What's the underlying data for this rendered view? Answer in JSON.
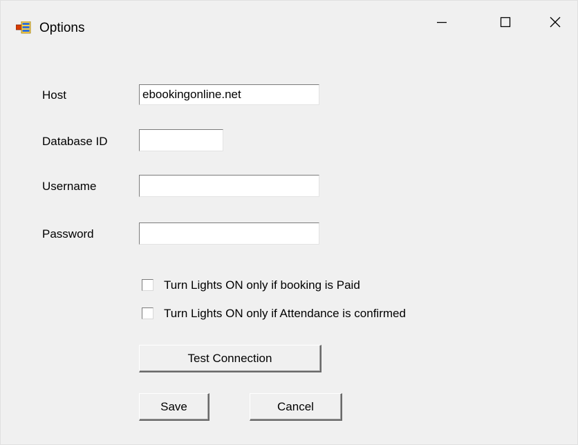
{
  "window": {
    "title": "Options"
  },
  "form": {
    "host": {
      "label": "Host",
      "value": "ebookingonline.net"
    },
    "database_id": {
      "label": "Database ID",
      "value": ""
    },
    "username": {
      "label": "Username",
      "value": ""
    },
    "password": {
      "label": "Password",
      "value": ""
    },
    "checkboxes": [
      {
        "label": "Turn Lights ON only if booking is Paid",
        "checked": false
      },
      {
        "label": "Turn Lights ON only if Attendance is confirmed",
        "checked": false
      }
    ]
  },
  "buttons": {
    "test_connection": "Test Connection",
    "save": "Save",
    "cancel": "Cancel"
  },
  "icons": {
    "app": "window-app-icon",
    "minimize": "minimize-icon",
    "maximize": "maximize-icon",
    "close": "close-icon"
  }
}
